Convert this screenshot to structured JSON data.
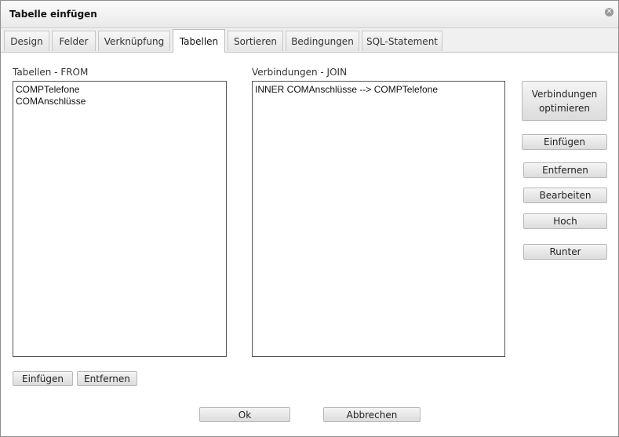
{
  "window": {
    "title": "Tabelle einfügen"
  },
  "tabs": [
    {
      "label": "Design"
    },
    {
      "label": "Felder"
    },
    {
      "label": "Verknüpfung"
    },
    {
      "label": "Tabellen"
    },
    {
      "label": "Sortieren"
    },
    {
      "label": "Bedingungen"
    },
    {
      "label": "SQL-Statement"
    }
  ],
  "active_tab": "Tabellen",
  "tables": {
    "label": "Tabellen - FROM",
    "items": [
      "COMPTelefone",
      "COMAnschlüsse"
    ],
    "insert_label": "Einfügen",
    "remove_label": "Entfernen"
  },
  "joins": {
    "label": "Verbindungen - JOIN",
    "items": [
      "INNER COMAnschlüsse --> COMPTelefone"
    ]
  },
  "side_buttons": {
    "optimize": "Verbindungen optimieren",
    "insert": "Einfügen",
    "remove": "Entfernen",
    "edit": "Bearbeiten",
    "up": "Hoch",
    "down": "Runter"
  },
  "footer": {
    "ok": "Ok",
    "cancel": "Abbrechen"
  },
  "icons": {
    "close": "close-icon"
  }
}
